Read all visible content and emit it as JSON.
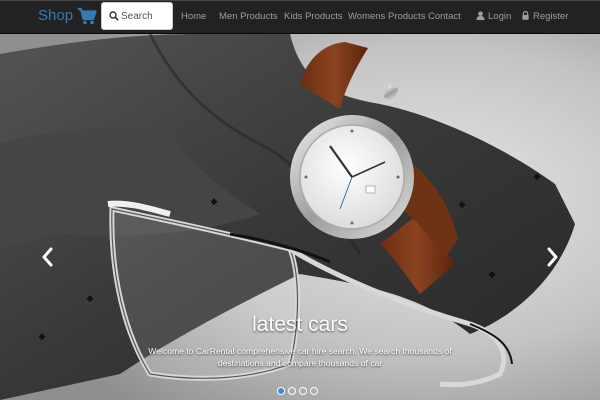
{
  "navbar": {
    "brand": "Shop",
    "search_placeholder": "Search",
    "links": [
      "Home",
      "Men Products",
      "Kids Products",
      "Womens Products",
      "Contact"
    ],
    "login_label": "Login",
    "register_label": "Register",
    "brand_color": "#337ab7",
    "link_color": "#9d9d9d",
    "background": "#222222"
  },
  "carousel": {
    "caption_title": "latest cars",
    "caption_text": "Welcome to CarRental comprehensive car hire search. We search thousands of destinations and compare thousands of car",
    "slide_count": 4,
    "active_slide": 1,
    "indicator_active_color": "#428bca"
  },
  "icons": {
    "cart": "shopping-cart-icon",
    "search": "search-icon",
    "login": "user-icon",
    "register": "lock-icon",
    "prev": "chevron-left-icon",
    "next": "chevron-right-icon"
  }
}
